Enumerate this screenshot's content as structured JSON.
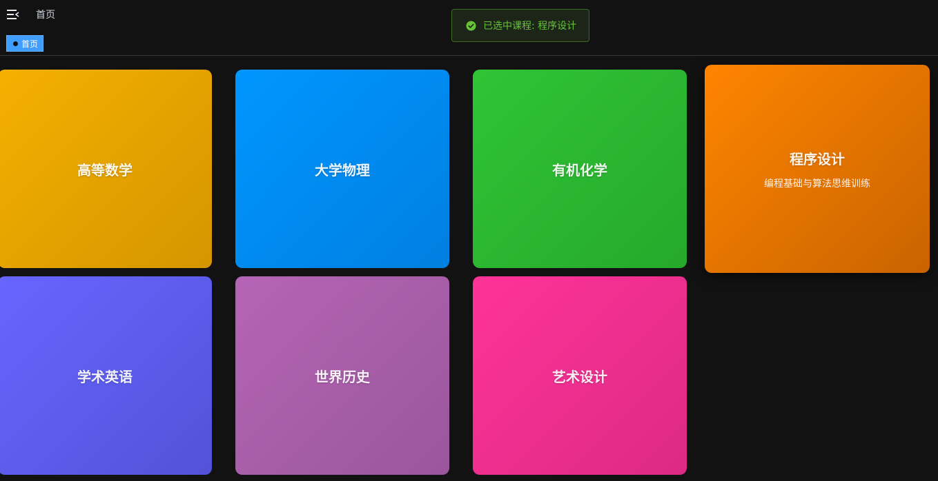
{
  "header": {
    "breadcrumb": "首页",
    "tag_label": "首页"
  },
  "toast": {
    "message": "已选中课程: 程序设计"
  },
  "courses": [
    {
      "title": "高等数学",
      "subtitle": "",
      "from": "#f5b000",
      "to": "#d49600"
    },
    {
      "title": "大学物理",
      "subtitle": "",
      "from": "#0096ff",
      "to": "#007fe0"
    },
    {
      "title": "有机化学",
      "subtitle": "",
      "from": "#30c435",
      "to": "#25a92b"
    },
    {
      "title": "程序设计",
      "subtitle": "编程基础与算法思维训练",
      "from": "#ff8500",
      "to": "#c96300"
    },
    {
      "title": "学术英语",
      "subtitle": "",
      "from": "#6666ff",
      "to": "#5352d9"
    },
    {
      "title": "世界历史",
      "subtitle": "",
      "from": "#b565b5",
      "to": "#9a569c"
    },
    {
      "title": "艺术设计",
      "subtitle": "",
      "from": "#ff3399",
      "to": "#dc2a83"
    }
  ],
  "colors": {
    "background": "#121212",
    "accent": "#409eff",
    "success": "#67c23a"
  }
}
